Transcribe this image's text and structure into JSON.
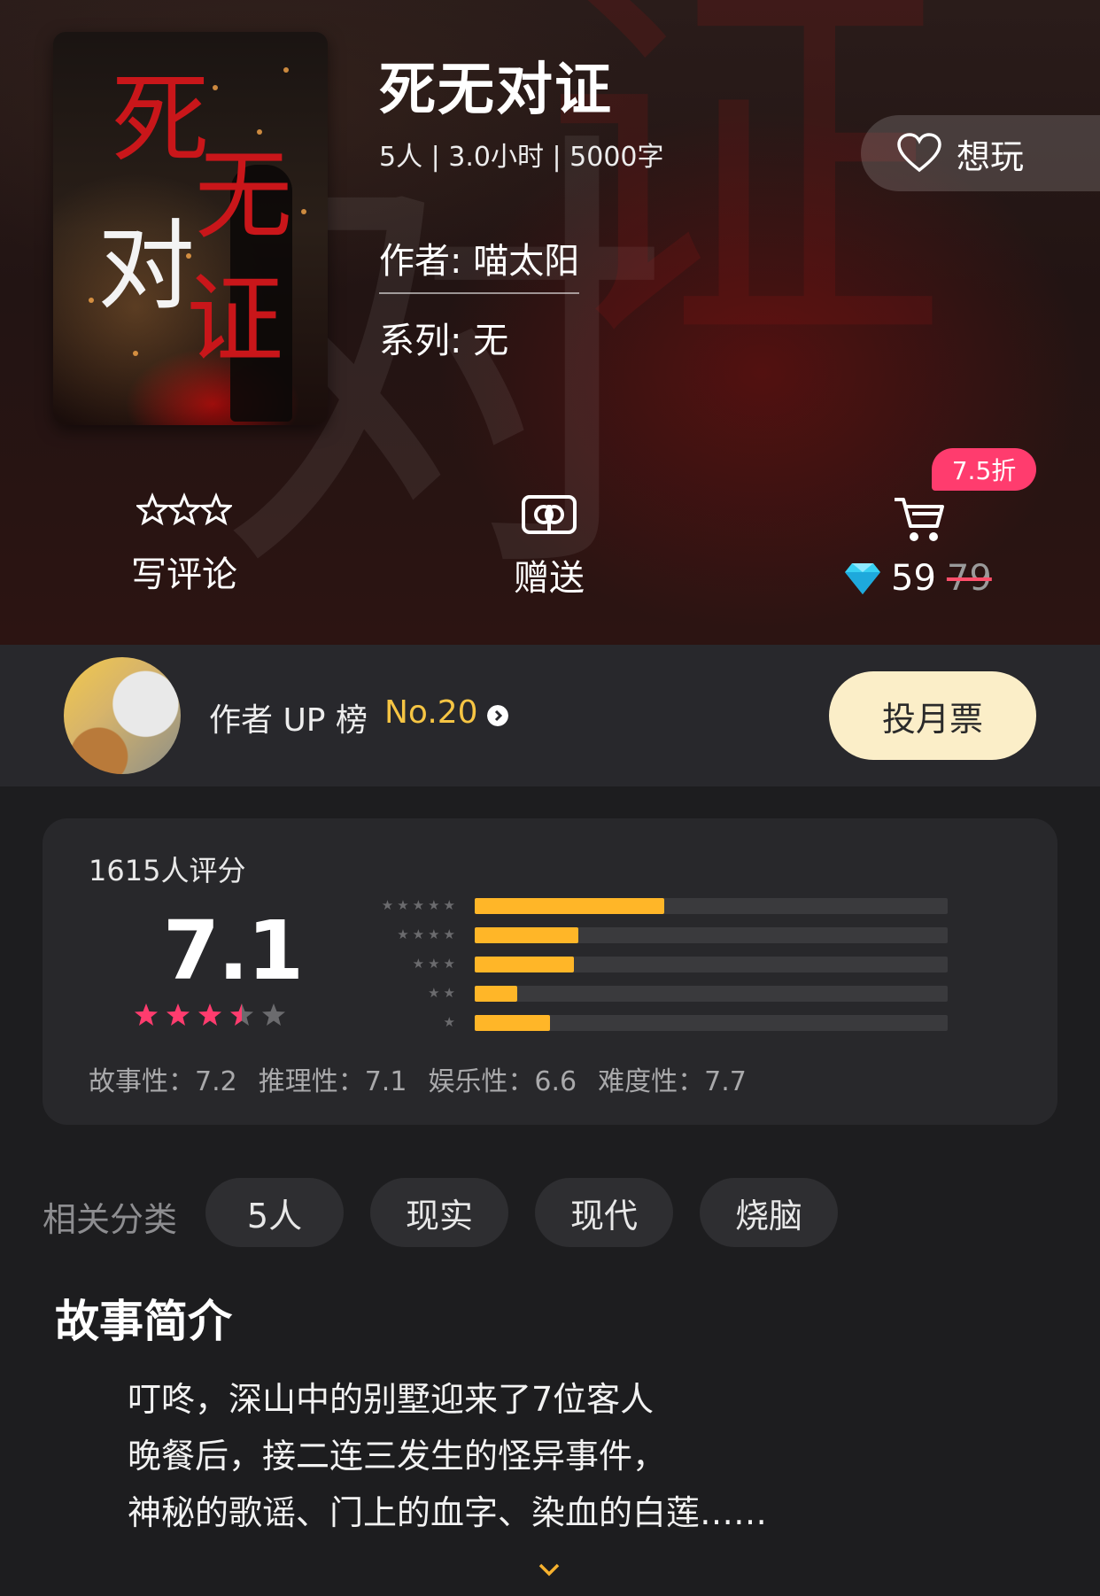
{
  "hero": {
    "cover_title_chars": [
      "死",
      "无",
      "对",
      "证"
    ],
    "title": "死无对证",
    "meta": "5人 | 3.0小时 | 5000字",
    "author": "作者: 喵太阳",
    "series": "系列: 无",
    "want_label": "想玩",
    "actions": {
      "review_label": "写评论",
      "gift_label": "赠送",
      "discount_badge": "7.5折",
      "price_now": "59",
      "price_old": "79"
    }
  },
  "up_bar": {
    "label": "作者 UP 榜",
    "rank": "No.20",
    "vote_label": "投月票"
  },
  "rating": {
    "count_text": "1615人评分",
    "score": "7.1",
    "star_rating": 3.5,
    "distribution": [
      {
        "stars": 5,
        "fraction": 0.4
      },
      {
        "stars": 4,
        "fraction": 0.22
      },
      {
        "stars": 3,
        "fraction": 0.21
      },
      {
        "stars": 2,
        "fraction": 0.09
      },
      {
        "stars": 1,
        "fraction": 0.16
      }
    ],
    "sub_scores": [
      {
        "text": "故事性：7.2"
      },
      {
        "text": "推理性：7.1"
      },
      {
        "text": "娱乐性：6.6"
      },
      {
        "text": "难度性：7.7"
      }
    ]
  },
  "categories": {
    "label": "相关分类",
    "tags": [
      "5人",
      "现实",
      "现代",
      "烧脑"
    ]
  },
  "synopsis": {
    "title": "故事简介",
    "lines": [
      "叮咚，深山中的别墅迎来了7位客人",
      "晚餐后，接二连三发生的怪异事件，",
      "神秘的歌谣、门上的血字、染血的白莲……"
    ]
  },
  "colors": {
    "accent_yellow": "#ffb628",
    "rank_gold": "#f6c544",
    "star_pink": "#ff3c6e",
    "vote_bg": "#fbeec8"
  },
  "icons": [
    "heart-icon",
    "star-outline-icon",
    "gift-icon",
    "cart-icon",
    "diamond-icon",
    "chevron-right-icon",
    "chevron-down-icon"
  ]
}
